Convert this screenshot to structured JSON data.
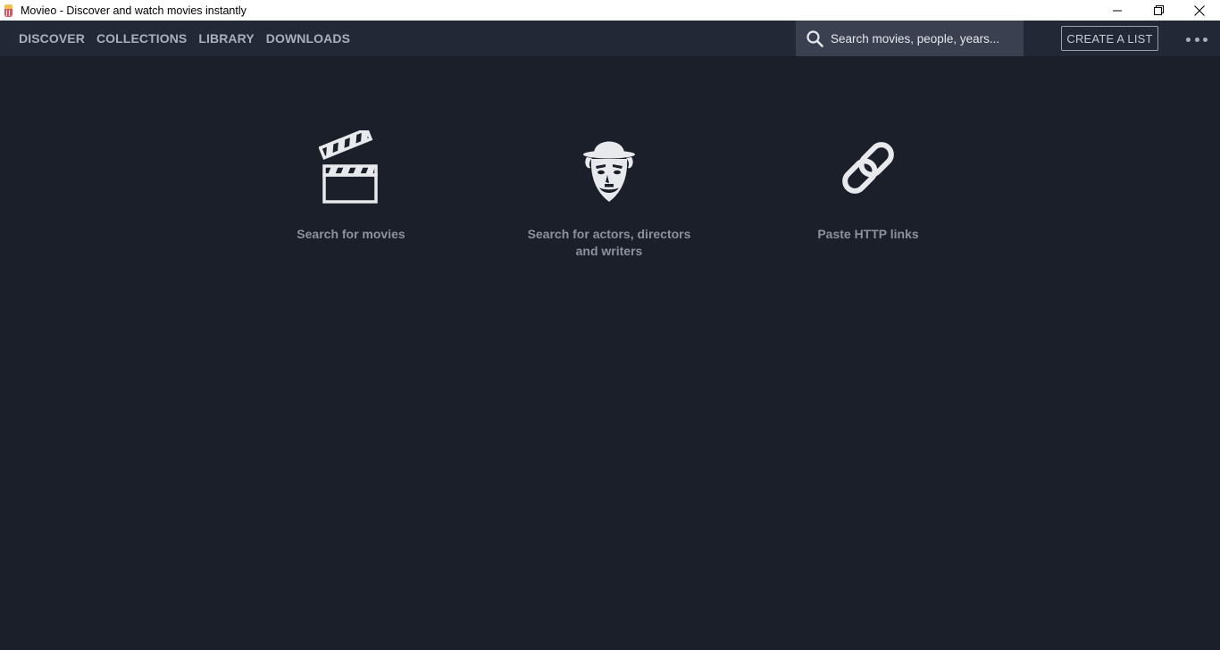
{
  "window": {
    "title": "Movieo - Discover and watch movies instantly"
  },
  "nav": {
    "items": [
      {
        "label": "DISCOVER"
      },
      {
        "label": "COLLECTIONS"
      },
      {
        "label": "LIBRARY"
      },
      {
        "label": "DOWNLOADS"
      }
    ]
  },
  "search": {
    "placeholder": "Search movies, people, years..."
  },
  "actions": {
    "create_list_label": "CREATE A LIST"
  },
  "features": [
    {
      "icon": "clapperboard-icon",
      "label": "Search for movies"
    },
    {
      "icon": "actor-face-icon",
      "label_line1": "Search for actors, directors",
      "label_line2": "and writers"
    },
    {
      "icon": "link-icon",
      "label": "Paste HTTP links"
    }
  ],
  "colors": {
    "background": "#1b1f2a",
    "navbar": "#232836",
    "search_bg": "#3a4050",
    "nav_text": "#a9afbd",
    "feature_text": "#8b919e",
    "icon": "#e8e9ec"
  }
}
